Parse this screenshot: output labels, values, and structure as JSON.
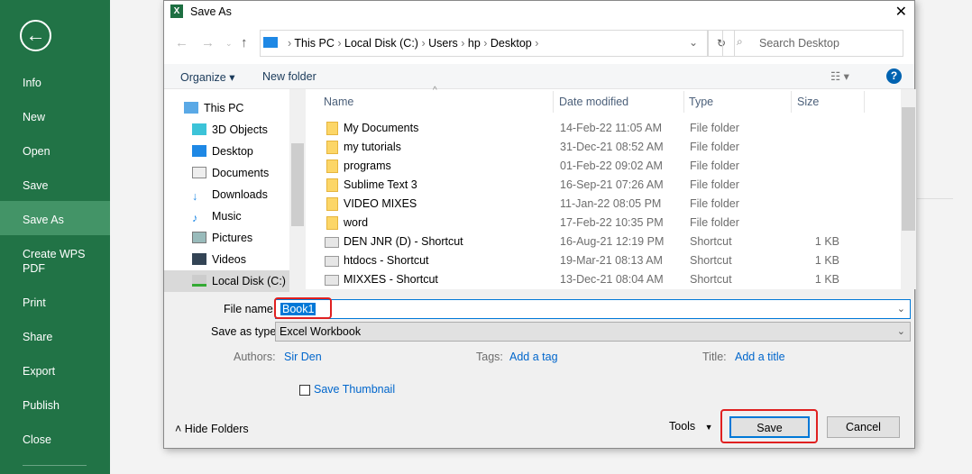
{
  "backstage": {
    "items": [
      "Info",
      "New",
      "Open",
      "Save",
      "Save As",
      "Create WPS PDF",
      "Print",
      "Share",
      "Export",
      "Publish",
      "Close"
    ],
    "selected": "Save As",
    "accent": "#217346"
  },
  "dialog": {
    "title": "Save As",
    "breadcrumb": [
      "This PC",
      "Local Disk (C:)",
      "Users",
      "hp",
      "Desktop"
    ],
    "search_placeholder": "Search Desktop",
    "toolbar": {
      "organize": "Organize",
      "new_folder": "New folder"
    },
    "nav_pane": [
      {
        "label": "This PC",
        "icon": "pc-icon"
      },
      {
        "label": "3D Objects",
        "icon": "cube-icon"
      },
      {
        "label": "Desktop",
        "icon": "desktop-icon"
      },
      {
        "label": "Documents",
        "icon": "document-icon"
      },
      {
        "label": "Downloads",
        "icon": "download-icon"
      },
      {
        "label": "Music",
        "icon": "music-icon"
      },
      {
        "label": "Pictures",
        "icon": "picture-icon"
      },
      {
        "label": "Videos",
        "icon": "video-icon"
      },
      {
        "label": "Local Disk (C:)",
        "icon": "drive-icon",
        "selected": true
      }
    ],
    "columns": [
      "Name",
      "Date modified",
      "Type",
      "Size"
    ],
    "files": [
      {
        "name": "My Documents",
        "date": "14-Feb-22 11:05 AM",
        "type": "File folder",
        "size": ""
      },
      {
        "name": "my tutorials",
        "date": "31-Dec-21 08:52 AM",
        "type": "File folder",
        "size": ""
      },
      {
        "name": "programs",
        "date": "01-Feb-22 09:02 AM",
        "type": "File folder",
        "size": ""
      },
      {
        "name": "Sublime Text 3",
        "date": "16-Sep-21 07:26 AM",
        "type": "File folder",
        "size": ""
      },
      {
        "name": "VIDEO MIXES",
        "date": "11-Jan-22 08:05 PM",
        "type": "File folder",
        "size": ""
      },
      {
        "name": "word",
        "date": "17-Feb-22 10:35 PM",
        "type": "File folder",
        "size": ""
      },
      {
        "name": "DEN JNR (D) - Shortcut",
        "date": "16-Aug-21 12:19 PM",
        "type": "Shortcut",
        "size": "1 KB"
      },
      {
        "name": "htdocs - Shortcut",
        "date": "19-Mar-21 08:13 AM",
        "type": "Shortcut",
        "size": "1 KB"
      },
      {
        "name": "MIXXES - Shortcut",
        "date": "13-Dec-21 08:04 AM",
        "type": "Shortcut",
        "size": "1 KB"
      }
    ],
    "file_name_label": "File name:",
    "file_name": "Book1",
    "save_type_label": "Save as type:",
    "save_type": "Excel Workbook",
    "authors_label": "Authors:",
    "authors": "Sir Den",
    "tags_label": "Tags:",
    "tags": "Add a tag",
    "title_label": "Title:",
    "title_value": "Add a title",
    "thumbnail_label": "Save Thumbnail",
    "hide_folders": "Hide Folders",
    "tools": "Tools",
    "save": "Save",
    "cancel": "Cancel"
  }
}
